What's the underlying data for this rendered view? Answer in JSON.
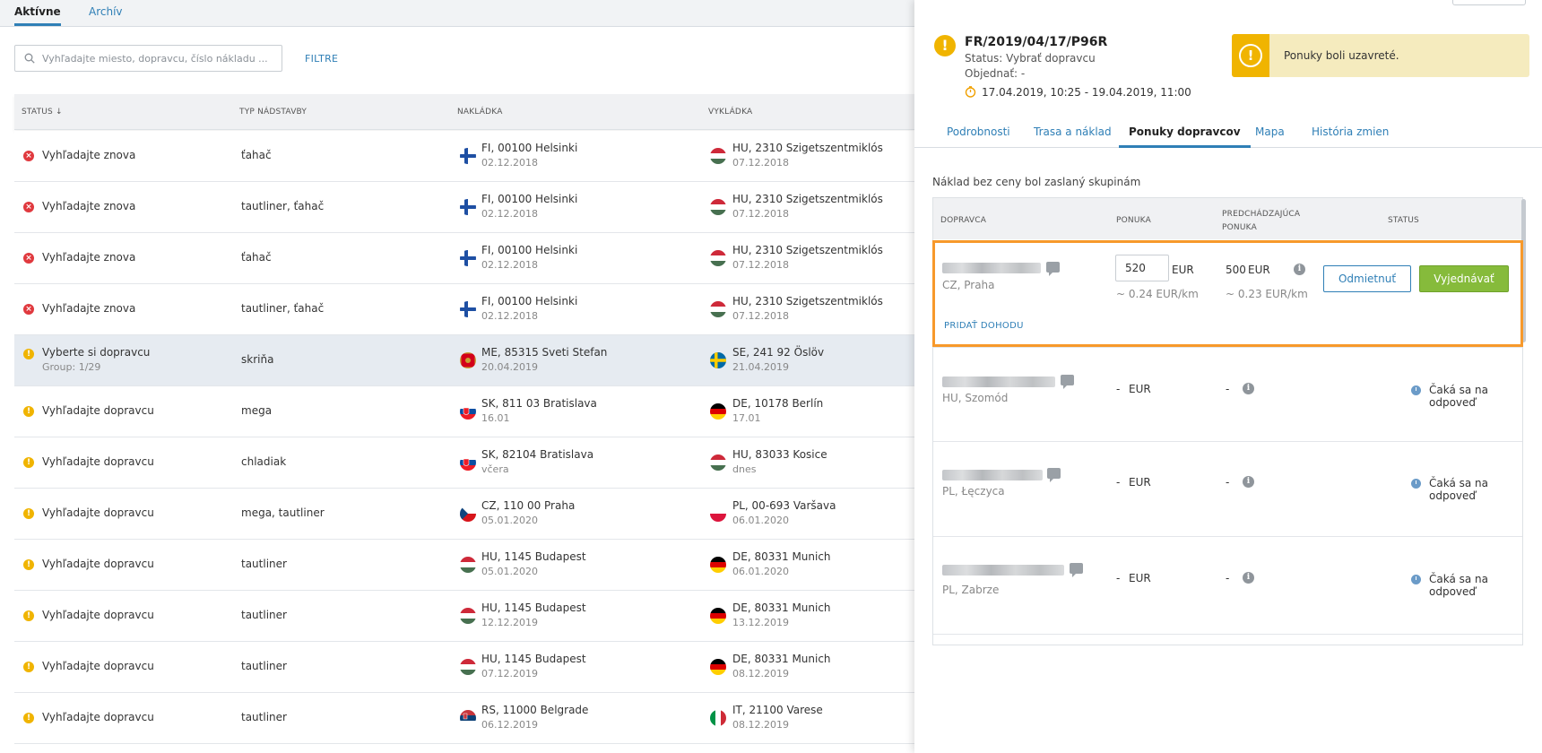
{
  "left": {
    "tabs": {
      "active": "Aktívne",
      "archive": "Archív"
    },
    "search": {
      "placeholder": "Vyhľadajte miesto, dopravcu, číslo nákladu ..."
    },
    "filter_label": "FILTRE",
    "headers": {
      "status": "STATUS ↓",
      "type": "TYP NÁDSTAVBY",
      "load": "NAKLÁDKA",
      "unload": "VYKLÁDKA"
    },
    "rows": [
      {
        "status": "Vyhľadajte znova",
        "status_kind": "error",
        "type": "ťahač",
        "load_flag": "fi",
        "load": "FI, 00100 Helsinki",
        "load_date": "02.12.2018",
        "unload_flag": "hu",
        "unload": "HU, 2310 Szigetszentmiklós",
        "unload_date": "07.12.2018"
      },
      {
        "status": "Vyhľadajte znova",
        "status_kind": "error",
        "type": "tautliner, ťahač",
        "load_flag": "fi",
        "load": "FI, 00100 Helsinki",
        "load_date": "02.12.2018",
        "unload_flag": "hu",
        "unload": "HU, 2310 Szigetszentmiklós",
        "unload_date": "07.12.2018"
      },
      {
        "status": "Vyhľadajte znova",
        "status_kind": "error",
        "type": "ťahač",
        "load_flag": "fi",
        "load": "FI, 00100 Helsinki",
        "load_date": "02.12.2018",
        "unload_flag": "hu",
        "unload": "HU, 2310 Szigetszentmiklós",
        "unload_date": "07.12.2018"
      },
      {
        "status": "Vyhľadajte znova",
        "status_kind": "error",
        "type": "tautliner, ťahač",
        "load_flag": "fi",
        "load": "FI, 00100 Helsinki",
        "load_date": "02.12.2018",
        "unload_flag": "hu",
        "unload": "HU, 2310 Szigetszentmiklós",
        "unload_date": "07.12.2018"
      },
      {
        "status": "Vyberte si dopravcu",
        "status_sub": "Group: 1/29",
        "status_kind": "warning",
        "selected": true,
        "type": "skriňa",
        "load_flag": "me",
        "load": "ME, 85315 Sveti Stefan",
        "load_date": "20.04.2019",
        "unload_flag": "se",
        "unload": "SE, 241 92 Öslöv",
        "unload_date": "21.04.2019"
      },
      {
        "status": "Vyhľadajte dopravcu",
        "status_kind": "warning",
        "type": "mega",
        "load_flag": "sk",
        "load": "SK, 811 03 Bratislava",
        "load_date": "16.01",
        "unload_flag": "de",
        "unload": "DE, 10178 Berlín",
        "unload_date": "17.01"
      },
      {
        "status": "Vyhľadajte dopravcu",
        "status_kind": "warning",
        "type": "chladiak",
        "load_flag": "sk",
        "load": "SK, 82104 Bratislava",
        "load_date": "včera",
        "unload_flag": "hu",
        "unload": "HU, 83033 Kosice",
        "unload_date": "dnes"
      },
      {
        "status": "Vyhľadajte dopravcu",
        "status_kind": "warning",
        "type": "mega, tautliner",
        "load_flag": "cz",
        "load": "CZ, 110 00 Praha",
        "load_date": "05.01.2020",
        "unload_flag": "pl",
        "unload": "PL, 00-693 Varšava",
        "unload_date": "06.01.2020"
      },
      {
        "status": "Vyhľadajte dopravcu",
        "status_kind": "warning",
        "type": "tautliner",
        "load_flag": "hu",
        "load": "HU, 1145 Budapest",
        "load_date": "05.01.2020",
        "unload_flag": "de",
        "unload": "DE, 80331 Munich",
        "unload_date": "06.01.2020"
      },
      {
        "status": "Vyhľadajte dopravcu",
        "status_kind": "warning",
        "type": "tautliner",
        "load_flag": "hu",
        "load": "HU, 1145 Budapest",
        "load_date": "12.12.2019",
        "unload_flag": "de",
        "unload": "DE, 80331 Munich",
        "unload_date": "13.12.2019"
      },
      {
        "status": "Vyhľadajte dopravcu",
        "status_kind": "warning",
        "type": "tautliner",
        "load_flag": "hu",
        "load": "HU, 1145 Budapest",
        "load_date": "07.12.2019",
        "unload_flag": "de",
        "unload": "DE, 80331 Munich",
        "unload_date": "08.12.2019"
      },
      {
        "status": "Vyhľadajte dopravcu",
        "status_kind": "warning",
        "type": "tautliner",
        "load_flag": "rs",
        "load": "RS, 11000 Belgrade",
        "load_date": "06.12.2019",
        "unload_flag": "it",
        "unload": "IT, 21100 Varese",
        "unload_date": "08.12.2019"
      }
    ]
  },
  "detail": {
    "order_no": "FR/2019/04/17/P96R",
    "status_line": "Status: Vybrať dopravcu",
    "ordered_line": "Objednať: -",
    "dates": "17.04.2019, 10:25 - 19.04.2019, 11:00",
    "notice": "Ponuky boli uzavreté.",
    "tabs": [
      "Podrobnosti",
      "Trasa a náklad",
      "Ponuky dopravcov",
      "Mapa",
      "História zmien"
    ],
    "info_line": "Náklad bez ceny bol zaslaný skupinám",
    "offer_headers": {
      "carrier": "DOPRAVCA",
      "offer": "PONUKA",
      "prev": "PREDCHÁDZAJÚCA PONUKA",
      "status": "STATUS"
    },
    "first_offer": {
      "location": "CZ, Praha",
      "value": "520",
      "currency": "EUR",
      "per_km": "~ 0.24 EUR/km",
      "prev_value": "500",
      "prev_currency": "EUR",
      "prev_per_km": "~ 0.23 EUR/km",
      "decline": "Odmietnuť",
      "negotiate": "Vyjednávať",
      "add_deal": "PRIDAŤ DOHODU"
    },
    "other_offers": [
      {
        "location": "HU, Szomód",
        "offer": "-",
        "currency": "EUR",
        "prev": "-",
        "status": "Čaká sa na odpoveď"
      },
      {
        "location": "PL, Łęczyca",
        "offer": "-",
        "currency": "EUR",
        "prev": "-",
        "status": "Čaká sa na odpoveď"
      },
      {
        "location": "PL, Zabrze",
        "offer": "-",
        "currency": "EUR",
        "prev": "-",
        "status": "Čaká sa na odpoveď"
      }
    ]
  },
  "colors": {
    "accent": "#2f7fb6",
    "warning": "#f0b400",
    "error": "#e0393e",
    "highlight": "#f7992b",
    "success": "#86bb3b"
  }
}
